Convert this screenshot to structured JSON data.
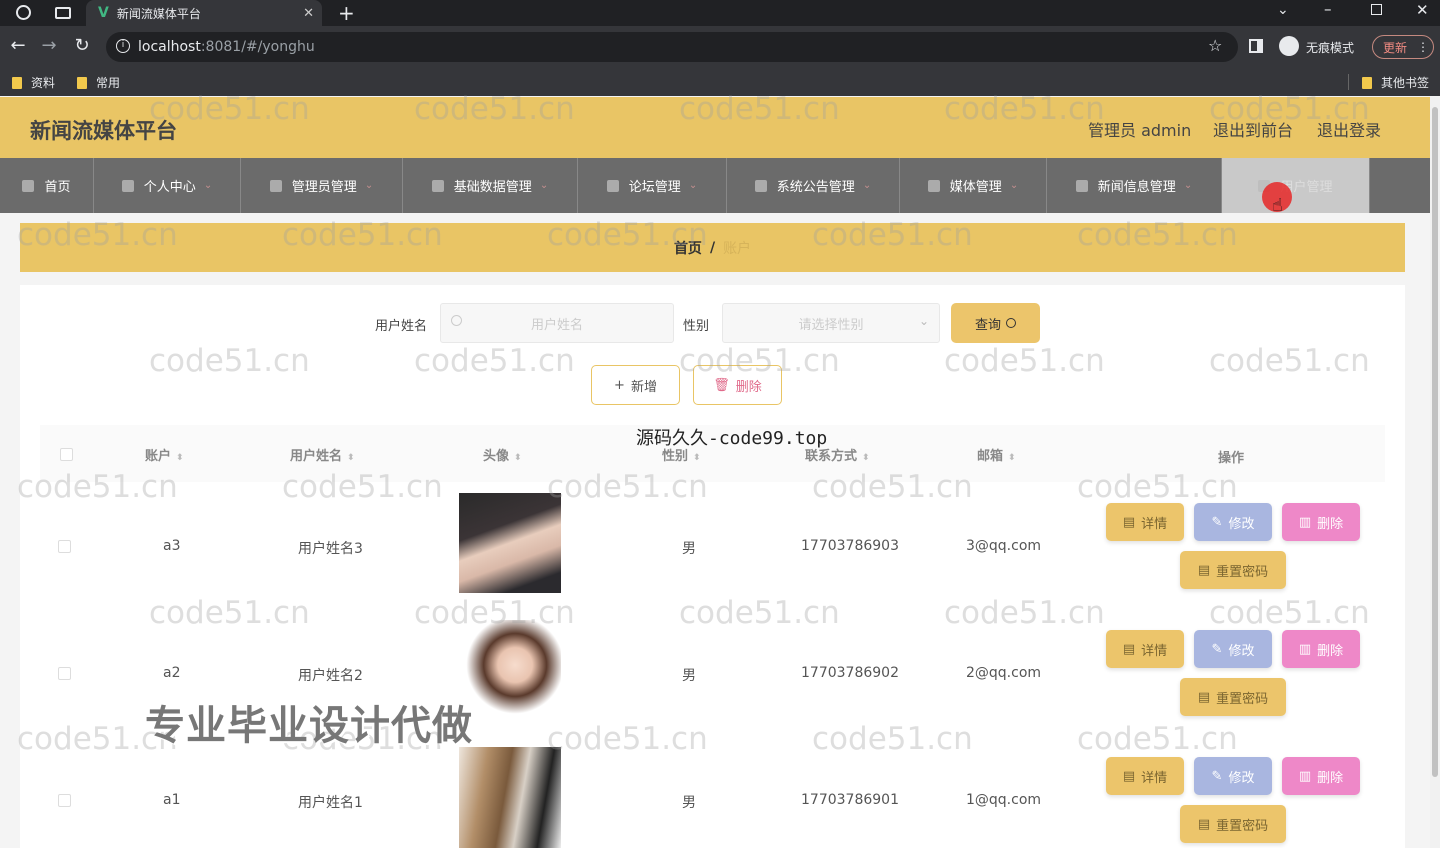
{
  "browser": {
    "tab_title": "新闻流媒体平台",
    "url_host": "localhost",
    "url_path": ":8081/#/yonghu",
    "incognito_label": "无痕模式",
    "update_label": "更新",
    "bookmarks": [
      "资料",
      "常用"
    ],
    "other_bookmarks": "其他书签"
  },
  "header": {
    "site_title": "新闻流媒体平台",
    "admin_label": "管理员 admin",
    "to_front": "退出到前台",
    "logout": "退出登录"
  },
  "nav": [
    {
      "label": "首页"
    },
    {
      "label": "个人中心"
    },
    {
      "label": "管理员管理"
    },
    {
      "label": "基础数据管理"
    },
    {
      "label": "论坛管理"
    },
    {
      "label": "系统公告管理"
    },
    {
      "label": "媒体管理"
    },
    {
      "label": "新闻信息管理"
    },
    {
      "label": "用户管理"
    }
  ],
  "breadcrumb": {
    "home": "首页",
    "sep": "/",
    "current": "账户"
  },
  "search": {
    "name_label": "用户姓名",
    "name_placeholder": "用户姓名",
    "gender_label": "性别",
    "gender_placeholder": "请选择性别",
    "query_button": "查询"
  },
  "actions": {
    "add": "新增",
    "delete": "删除"
  },
  "table": {
    "columns": [
      "账户",
      "用户姓名",
      "头像",
      "性别",
      "联系方式",
      "邮箱",
      "操作"
    ],
    "rows": [
      {
        "account": "a3",
        "name": "用户姓名3",
        "gender": "男",
        "phone": "17703786903",
        "email": "3@qq.com"
      },
      {
        "account": "a2",
        "name": "用户姓名2",
        "gender": "男",
        "phone": "17703786902",
        "email": "2@qq.com"
      },
      {
        "account": "a1",
        "name": "用户姓名1",
        "gender": "男",
        "phone": "17703786901",
        "email": "1@qq.com"
      }
    ],
    "row_actions": {
      "detail": "详情",
      "edit": "修改",
      "delete": "删除",
      "reset": "重置密码"
    }
  },
  "overlays": {
    "watermark": "code51.cn",
    "mark99": "源码久久-code99.top",
    "banner": "专业毕业设计代做"
  },
  "colors": {
    "accent": "#e9c565",
    "nav_bg": "#6b6b6b",
    "delete_pink": "#ee88c8",
    "edit_blue": "#a9b6e0"
  }
}
